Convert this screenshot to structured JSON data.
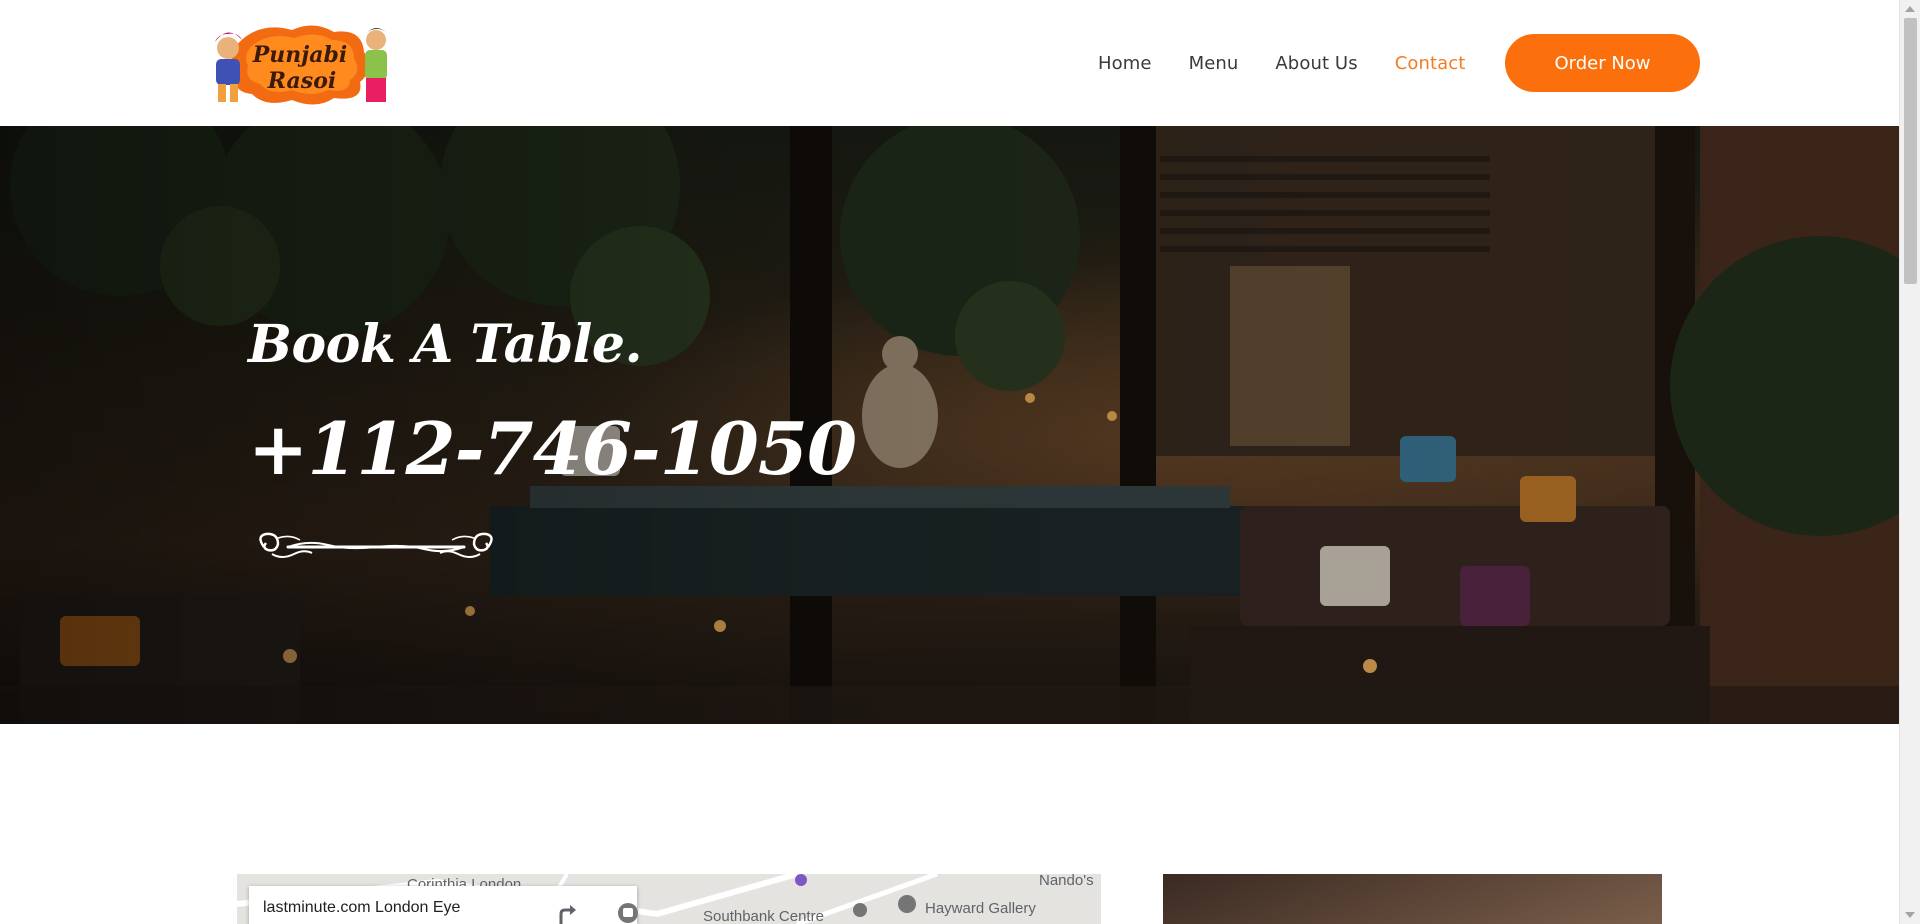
{
  "logo": {
    "line1": "Punjabi",
    "line2": "Rasoi",
    "icon": "punjabi-rasoi-logo"
  },
  "nav": {
    "items": [
      {
        "label": "Home",
        "active": false
      },
      {
        "label": "Menu",
        "active": false
      },
      {
        "label": "About Us",
        "active": false
      },
      {
        "label": "Contact",
        "active": true
      }
    ],
    "order_label": "Order Now"
  },
  "hero": {
    "title": "Book A Table.",
    "phone": "+112-746-1050",
    "flourish_icon": "ornamental-divider-icon"
  },
  "map": {
    "card_title": "lastminute.com London Eye",
    "labels": [
      "Corinthia London",
      "Southbank Centre",
      "Hayward Gallery",
      "Nando's"
    ]
  },
  "colors": {
    "accent": "#fb6f0c",
    "active_nav": "#f47c20",
    "nav_text": "#3a3a3a"
  }
}
